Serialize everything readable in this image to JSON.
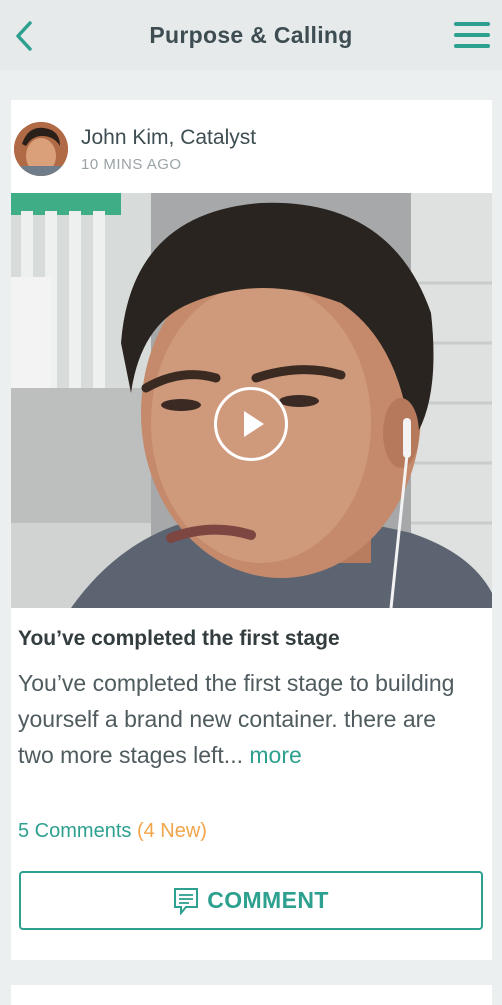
{
  "header": {
    "title": "Purpose & Calling"
  },
  "post": {
    "author": "John Kim, Catalyst",
    "time": "10 MINS AGO",
    "title": "You’ve completed the first stage",
    "body": "You’ve completed the first stage to building yourself a brand new container. there are two more stages left...",
    "more_label": "more",
    "comments_label": "5 Comments",
    "new_label": "(4 New)",
    "comment_button_label": "COMMENT"
  },
  "colors": {
    "accent": "#2ea08f",
    "new_badge": "#f0a54a"
  },
  "icons": [
    "back-chevron-icon",
    "menu-icon",
    "play-icon",
    "comment-icon"
  ]
}
